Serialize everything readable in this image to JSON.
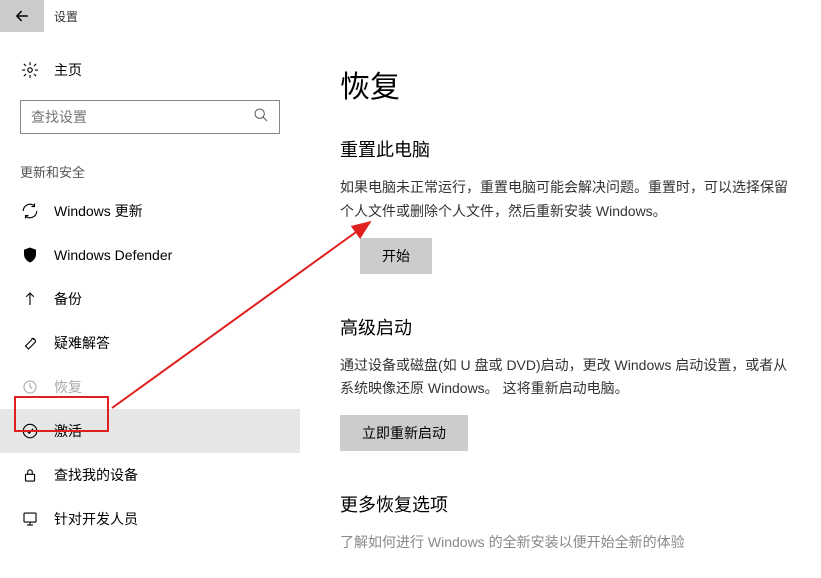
{
  "titlebar": {
    "app_name": "设置"
  },
  "sidebar": {
    "home_label": "主页",
    "search_placeholder": "查找设置",
    "section_title": "更新和安全",
    "items": [
      {
        "label": "Windows 更新"
      },
      {
        "label": "Windows Defender"
      },
      {
        "label": "备份"
      },
      {
        "label": "疑难解答"
      },
      {
        "label": "恢复"
      },
      {
        "label": "激活"
      },
      {
        "label": "查找我的设备"
      },
      {
        "label": "针对开发人员"
      }
    ]
  },
  "main": {
    "page_title": "恢复",
    "reset": {
      "heading": "重置此电脑",
      "desc": "如果电脑未正常运行，重置电脑可能会解决问题。重置时，可以选择保留个人文件或删除个人文件，然后重新安装 Windows。",
      "button": "开始"
    },
    "advanced": {
      "heading": "高级启动",
      "desc": "通过设备或磁盘(如 U 盘或 DVD)启动，更改 Windows 启动设置，或者从系统映像还原 Windows。 这将重新启动电脑。",
      "button": "立即重新启动"
    },
    "more": {
      "heading": "更多恢复选项",
      "desc": "了解如何进行 Windows 的全新安装以便开始全新的体验"
    }
  }
}
